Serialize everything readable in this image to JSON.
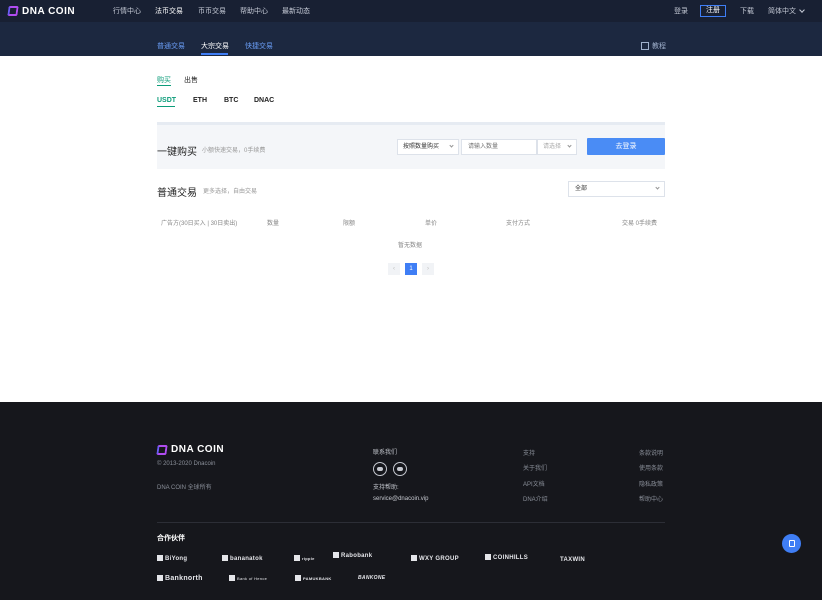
{
  "topnav": {
    "logo": "DNA COIN",
    "items": [
      {
        "label": "行情中心",
        "active": false
      },
      {
        "label": "法币交易",
        "active": true
      },
      {
        "label": "币币交易",
        "active": false
      },
      {
        "label": "帮助中心",
        "active": false
      },
      {
        "label": "最新动态",
        "active": false
      }
    ],
    "login": "登录",
    "register": "注册",
    "download": "下载",
    "language": "简体中文"
  },
  "subnav": {
    "tabs": [
      {
        "label": "普通交易",
        "active": false
      },
      {
        "label": "大宗交易",
        "active": true
      },
      {
        "label": "快捷交易",
        "active": false
      }
    ],
    "tutorial": "教程"
  },
  "trade": {
    "buy": "购买",
    "sell": "出售",
    "coins": [
      "USDT",
      "ETH",
      "BTC",
      "DNAC"
    ],
    "active_coin": "USDT"
  },
  "quick_buy": {
    "title": "一键购买",
    "subtitle": "小额快速交易，0手续费",
    "mode_select": "按照数量购买",
    "quantity_placeholder": "请输入数量",
    "unit_select": "请选择",
    "login_button": "去登录"
  },
  "normal_trade": {
    "title": "普通交易",
    "subtitle": "更多选择，自由交易",
    "filter": "全部",
    "columns": [
      "广告方(30日买入 | 30日卖出)",
      "数量",
      "限额",
      "单价",
      "支付方式",
      "交易 0手续费"
    ],
    "empty": "暂无数据",
    "pagination": {
      "prev": "‹",
      "current": "1",
      "next": "›"
    }
  },
  "footer": {
    "logo": "DNA COIN",
    "copyright": "© 2013-2020 Dnacoin",
    "rights": "DNA COIN 全球所有",
    "contact_label": "联系我们",
    "support_label": "支持帮助:",
    "email": "service@dnacoin.vip",
    "links_col1": [
      "支持",
      "关于我们",
      "API文档",
      "DNA介绍"
    ],
    "links_col2": [
      "条款说明",
      "使用条款",
      "隐私政策",
      "帮助中心"
    ],
    "partners_title": "合作伙伴",
    "partners_row1": [
      "BiYong",
      "bananatok",
      "ripple",
      "Rabobank",
      "WXY GROUP",
      "COINHILLS",
      "TAXWIN"
    ],
    "partners_row2": [
      "Banknorth",
      "Bank of Hence",
      "PAMUKBANK",
      "BANKONE"
    ]
  }
}
